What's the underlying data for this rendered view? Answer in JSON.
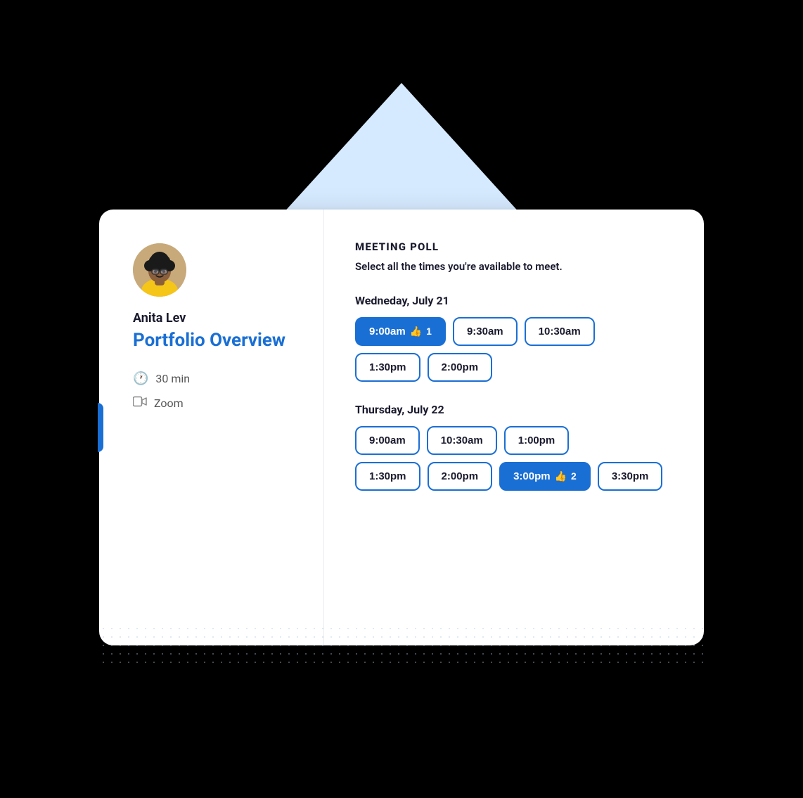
{
  "background": {
    "triangle_color": "#cfe2ff"
  },
  "left_panel": {
    "host_name": "Anita Lev",
    "meeting_title": "Portfolio Overview",
    "duration": "30 min",
    "location": "Zoom"
  },
  "right_panel": {
    "poll_title": "MEETING POLL",
    "poll_subtitle": "Select all the times you're available to meet.",
    "days": [
      {
        "label": "Wedneday, July 21",
        "rows": [
          [
            {
              "time": "9:00am",
              "selected": true,
              "votes": 1
            },
            {
              "time": "9:30am",
              "selected": false,
              "votes": 0
            },
            {
              "time": "10:30am",
              "selected": false,
              "votes": 0
            }
          ],
          [
            {
              "time": "1:30pm",
              "selected": false,
              "votes": 0
            },
            {
              "time": "2:00pm",
              "selected": false,
              "votes": 0
            }
          ]
        ]
      },
      {
        "label": "Thursday, July 22",
        "rows": [
          [
            {
              "time": "9:00am",
              "selected": false,
              "votes": 0
            },
            {
              "time": "10:30am",
              "selected": false,
              "votes": 0
            },
            {
              "time": "1:00pm",
              "selected": false,
              "votes": 0
            }
          ],
          [
            {
              "time": "1:30pm",
              "selected": false,
              "votes": 0
            },
            {
              "time": "2:00pm",
              "selected": false,
              "votes": 0
            },
            {
              "time": "3:00pm",
              "selected": true,
              "votes": 2
            },
            {
              "time": "3:30pm",
              "selected": false,
              "votes": 0
            }
          ]
        ]
      }
    ]
  },
  "meta": {
    "clock_icon": "🕐",
    "video_icon": "📹"
  }
}
